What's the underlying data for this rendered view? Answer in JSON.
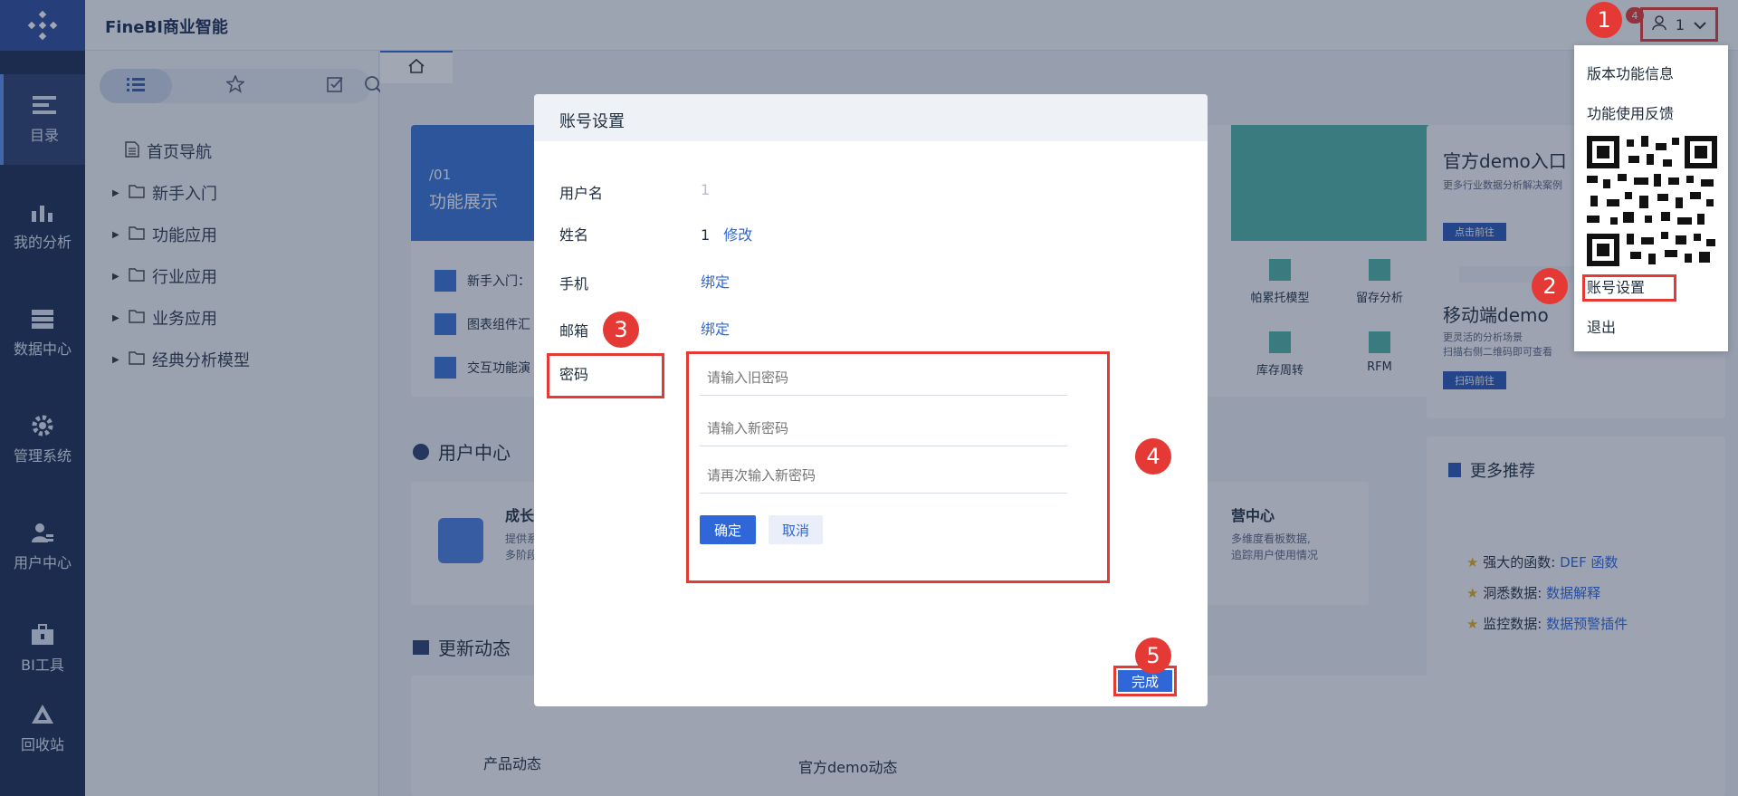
{
  "app": {
    "brand": "FineBI商业智能",
    "user_name": "1",
    "notification_count": "4"
  },
  "rail": {
    "items": [
      {
        "label": "目录",
        "icon": "catalog-icon"
      },
      {
        "label": "我的分析",
        "icon": "analysis-icon"
      },
      {
        "label": "数据中心",
        "icon": "database-icon"
      },
      {
        "label": "管理系统",
        "icon": "gear-icon"
      },
      {
        "label": "用户中心",
        "icon": "user-icon"
      },
      {
        "label": "BI工具",
        "icon": "toolbox-icon"
      },
      {
        "label": "回收站",
        "icon": "recycle-icon"
      }
    ]
  },
  "catalog": {
    "tree": [
      {
        "label": "首页导航",
        "type": "page"
      },
      {
        "label": "新手入门",
        "type": "folder"
      },
      {
        "label": "功能应用",
        "type": "folder"
      },
      {
        "label": "行业应用",
        "type": "folder"
      },
      {
        "label": "业务应用",
        "type": "folder"
      },
      {
        "label": "经典分析模型",
        "type": "folder"
      }
    ]
  },
  "home": {
    "banner_num": "/01",
    "banner_title": "功能展示",
    "list": [
      "新手入门：",
      "图表组件汇",
      "交互功能演"
    ],
    "user_center_title": "用户中心",
    "growth_title": "成长",
    "growth_desc1": "提供系",
    "growth_desc2": "多阶段",
    "ops_title": "营中心",
    "ops_desc1": "多维度看板数据,",
    "ops_desc2": "追踪用户使用情况",
    "models": [
      {
        "label": "帕累托模型"
      },
      {
        "label": "留存分析"
      },
      {
        "label": "库存周转"
      },
      {
        "label": "RFM"
      }
    ],
    "updates_title": "更新动态",
    "product_updates": "产品动态",
    "demo_updates": "官方demo动态",
    "demo_entry_title": "官方demo入口",
    "demo_entry_desc": "更多行业数据分析解决案例",
    "demo_entry_btn": "点击前往",
    "mobile_title": "移动端demo",
    "mobile_desc1": "更灵活的分析场景",
    "mobile_desc2": "扫描右侧二维码即可查看",
    "mobile_btn": "扫码前往",
    "more_title": "更多推荐",
    "recommendations": [
      {
        "prefix": "强大的函数:",
        "link": "DEF 函数"
      },
      {
        "prefix": "洞悉数据:",
        "link": "数据解释"
      },
      {
        "prefix": "监控数据:",
        "link": "数据预警插件"
      }
    ]
  },
  "menu": {
    "items": [
      "版本功能信息",
      "功能使用反馈",
      "账号设置",
      "退出"
    ]
  },
  "dialog": {
    "title": "账号设置",
    "username_label": "用户名",
    "username_value": "1",
    "name_label": "姓名",
    "name_value": "1",
    "edit_link": "修改",
    "phone_label": "手机",
    "phone_link": "绑定",
    "email_label": "邮箱",
    "email_link": "绑定",
    "password_label": "密码",
    "old_pwd_placeholder": "请输入旧密码",
    "new_pwd_placeholder": "请输入新密码",
    "confirm_pwd_placeholder": "请再次输入新密码",
    "confirm_btn": "确定",
    "cancel_btn": "取消",
    "done_btn": "完成"
  },
  "steps": [
    "1",
    "2",
    "3",
    "4",
    "5"
  ]
}
